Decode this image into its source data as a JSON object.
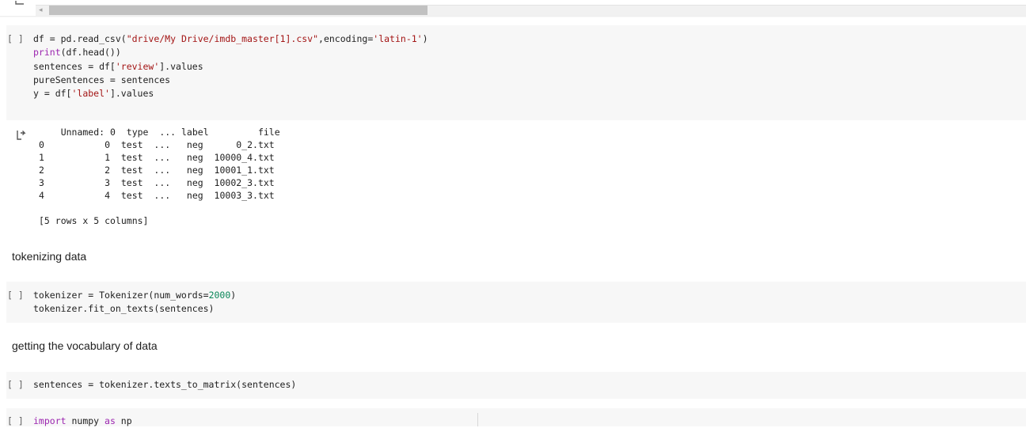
{
  "top_strip": {
    "scroll_left_arrow": "◂"
  },
  "cells": {
    "cell1": {
      "bracket": "[ ]",
      "lines": {
        "l1a": "df = pd.read_csv(",
        "l1b": "\"drive/My Drive/imdb_master[1].csv\"",
        "l1c": ",encoding=",
        "l1d": "'latin-1'",
        "l1e": ")",
        "l2a": "print",
        "l2b": "(df.head())",
        "l3a": "sentences = df[",
        "l3b": "'review'",
        "l3c": "].values",
        "l4": "pureSentences = sentences",
        "l5a": "y = df[",
        "l5b": "'label'",
        "l5c": "].values"
      }
    },
    "output1": {
      "text": "    Unnamed: 0  type  ... label         file\n0           0  test  ...   neg      0_2.txt\n1           1  test  ...   neg  10000_4.txt\n2           2  test  ...   neg  10001_1.txt\n3           3  test  ...   neg  10002_3.txt\n4           4  test  ...   neg  10003_3.txt\n\n[5 rows x 5 columns]"
    },
    "md1": "tokenizing data",
    "cell2": {
      "bracket": "[ ]",
      "l1a": "tokenizer = Tokenizer(num_words=",
      "l1b": "2000",
      "l1c": ")",
      "l2": "tokenizer.fit_on_texts(sentences)"
    },
    "md2": "getting the vocabulary of data",
    "cell3": {
      "bracket": "[ ]",
      "l1": "sentences = tokenizer.texts_to_matrix(sentences)"
    },
    "cell4": {
      "bracket": "[ ]",
      "l1a": "import",
      "l1b": " numpy ",
      "l1c": "as",
      "l1d": " np"
    }
  }
}
